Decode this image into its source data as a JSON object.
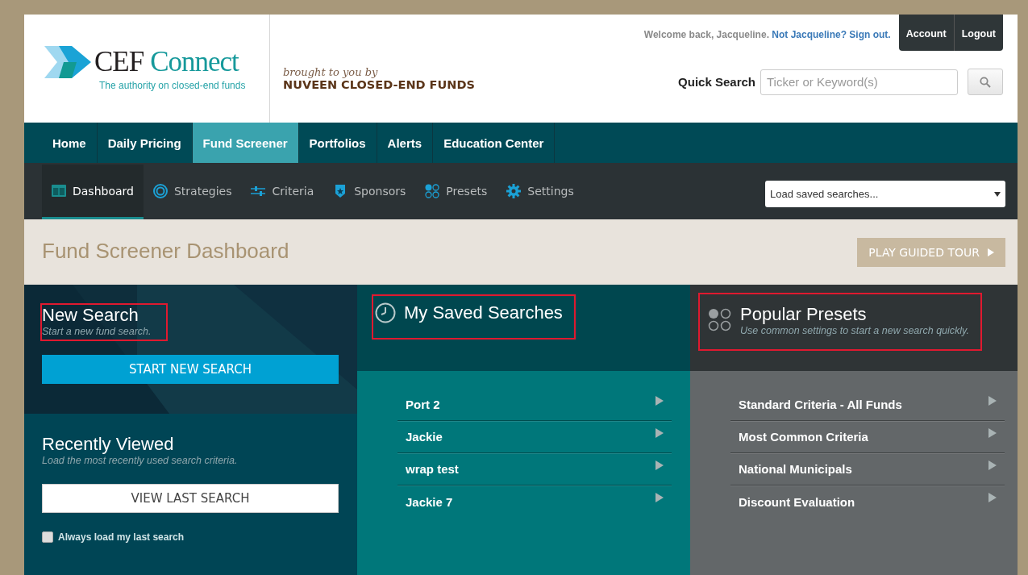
{
  "header": {
    "logo": {
      "brand_dark": "CEF",
      "brand_light": "Connect",
      "tagline": "The authority on closed-end funds"
    },
    "sponsor": {
      "intro": "brought to you by",
      "name": "NUVEEN CLOSED-END FUNDS"
    },
    "welcome": "Welcome back, Jacqueline.",
    "sign_out_link": "Not Jacqueline? Sign out.",
    "account_buttons": [
      "Account",
      "Logout"
    ],
    "quick_search": {
      "label": "Quick Search",
      "placeholder": "Ticker or Keyword(s)"
    }
  },
  "main_nav": [
    {
      "label": "Home",
      "selected": false
    },
    {
      "label": "Daily Pricing",
      "selected": false
    },
    {
      "label": "Fund Screener",
      "selected": true
    },
    {
      "label": "Portfolios",
      "selected": false
    },
    {
      "label": "Alerts",
      "selected": false
    },
    {
      "label": "Education Center",
      "selected": false
    }
  ],
  "sub_nav": [
    {
      "label": "Dashboard",
      "selected": true
    },
    {
      "label": "Strategies",
      "selected": false
    },
    {
      "label": "Criteria",
      "selected": false
    },
    {
      "label": "Sponsors",
      "selected": false
    },
    {
      "label": "Presets",
      "selected": false
    },
    {
      "label": "Settings",
      "selected": false
    }
  ],
  "saved_search_select": {
    "value": "Load saved searches..."
  },
  "page_title": "Fund Screener Dashboard",
  "tour_button": "PLAY GUIDED TOUR",
  "new_search": {
    "title": "New Search",
    "subtitle": "Start a new fund search.",
    "button": "START NEW SEARCH",
    "highlighted": true
  },
  "recently_viewed": {
    "title": "Recently Viewed",
    "subtitle": "Load the most recently used search criteria.",
    "button": "VIEW LAST SEARCH",
    "checkbox": {
      "label": "Always load my last search",
      "checked": false
    }
  },
  "saved_searches": {
    "title": "My Saved Searches",
    "highlighted": true,
    "items": [
      "Port 2",
      "Jackie",
      "wrap test",
      "Jackie 7"
    ]
  },
  "popular_presets": {
    "title": "Popular Presets",
    "subtitle": "Use common settings to start a new search quickly.",
    "highlighted": true,
    "items": [
      "Standard Criteria - All Funds",
      "Most Common Criteria",
      "National Municipals",
      "Discount Evaluation"
    ]
  }
}
